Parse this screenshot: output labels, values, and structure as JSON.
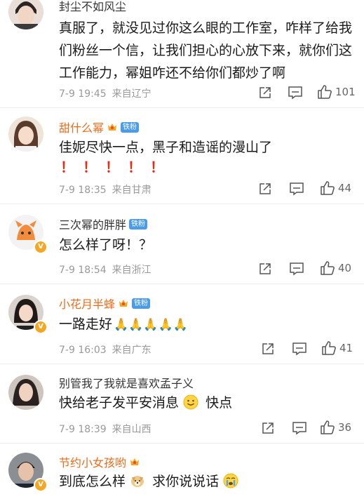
{
  "comments": [
    {
      "username": "封尘不如风尘",
      "text": "真服了，就没见过你这么眼的工作室，咋样了给我们粉丝一个信，让我们担心的心放下来，就你们这工作能力，幂姐咋还不给你们都炒了啊",
      "time": "7-9 19:45",
      "location": "来自辽宁",
      "likes": "101"
    },
    {
      "username": "甜什么幂",
      "badge": "铁粉",
      "text": "佳妮尽快一点，黑子和造谣的漫山了",
      "marks": "！！！！！",
      "time": "7-9 18:35",
      "location": "来自甘肃",
      "likes": "44"
    },
    {
      "username": "三次幂的胖胖",
      "badge": "铁粉",
      "text": "怎么样了呀！？",
      "time": "7-9 18:54",
      "location": "来自浙江",
      "likes": "40"
    },
    {
      "username": "小花月半蜂",
      "badge": "铁粉",
      "text": "一路走好",
      "emoji": "🙏🙏🙏🙏🙏",
      "time": "7-9 16:03",
      "location": "来自广东",
      "likes": "41"
    },
    {
      "username": "别管我了我就是喜欢孟子义",
      "text_a": "快给老子发平安消息",
      "text_b": "快点",
      "time": "7-9 18:39",
      "location": "来自山西",
      "likes": "36"
    },
    {
      "username": "节约小女孩哟",
      "text_a": "到底怎么样",
      "text_b": "求你说说话"
    }
  ],
  "colors": {
    "vip_name": "#ec6b1a",
    "fan_badge": "#4a9be8",
    "meta": "#999999",
    "exclaim": "#e62a1a"
  },
  "icons": [
    "share-icon",
    "comment-icon",
    "like-icon",
    "crown-icon"
  ]
}
